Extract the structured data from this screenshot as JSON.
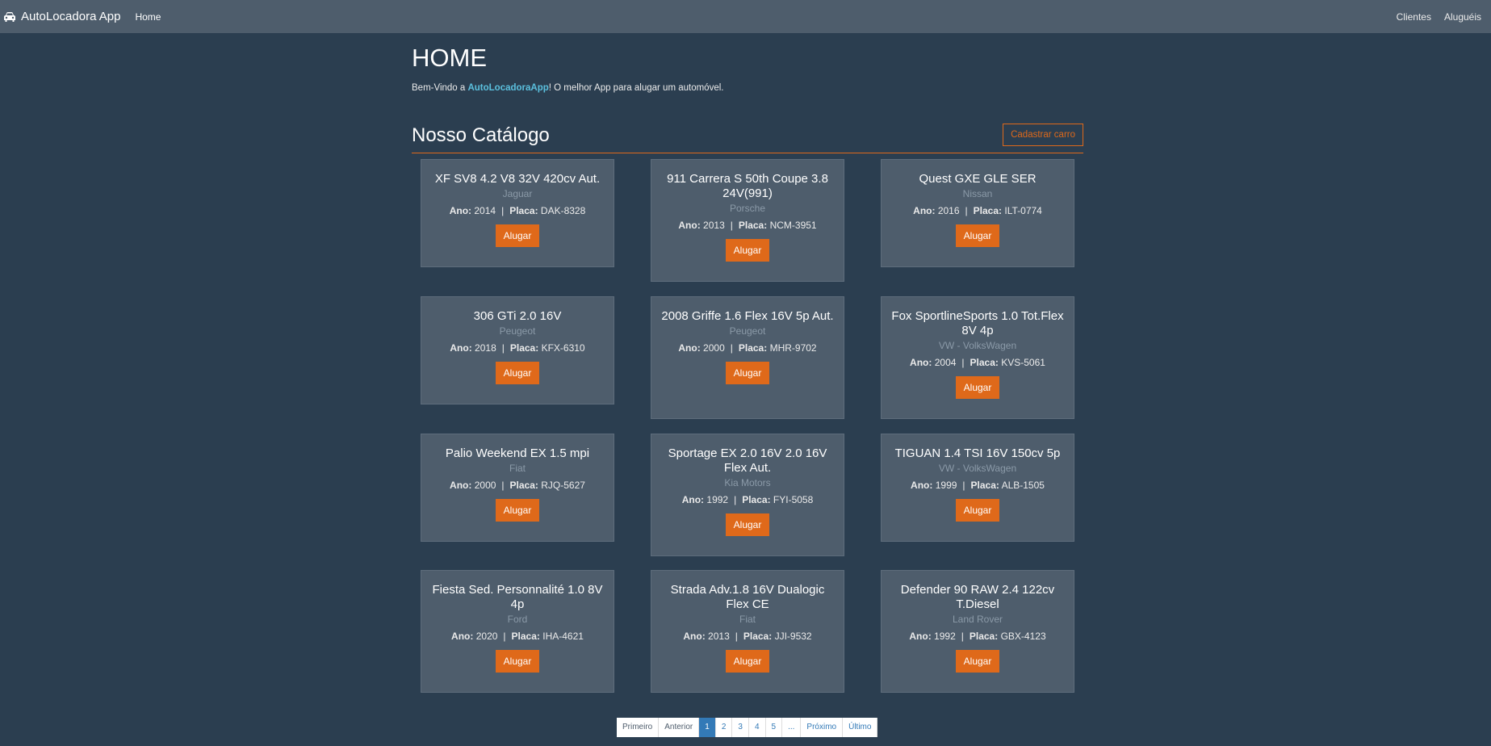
{
  "navbar": {
    "brand": "AutoLocadora App",
    "home": "Home",
    "right_links": [
      "Clientes",
      "Aluguéis"
    ]
  },
  "page": {
    "title": "HOME",
    "welcome_prefix": "Bem-Vindo a ",
    "welcome_highlight": "AutoLocadoraApp",
    "welcome_suffix": "! O melhor App para alugar um automóvel."
  },
  "catalog": {
    "title": "Nosso Catálogo",
    "add_button": "Cadastrar carro",
    "year_label": "Ano:",
    "plate_label": "Placa:",
    "rent_label": "Alugar",
    "cars": [
      {
        "model": "XF SV8 4.2 V8 32V 420cv Aut.",
        "brand": "Jaguar",
        "year": "2014",
        "plate": "DAK-8328"
      },
      {
        "model": "911 Carrera S 50th Coupe 3.8 24V(991)",
        "brand": "Porsche",
        "year": "2013",
        "plate": "NCM-3951"
      },
      {
        "model": "Quest GXE GLE SER",
        "brand": "Nissan",
        "year": "2016",
        "plate": "ILT-0774"
      },
      {
        "model": "306 GTi 2.0 16V",
        "brand": "Peugeot",
        "year": "2018",
        "plate": "KFX-6310"
      },
      {
        "model": "2008 Griffe 1.6 Flex 16V 5p Aut.",
        "brand": "Peugeot",
        "year": "2000",
        "plate": "MHR-9702"
      },
      {
        "model": "Fox SportlineSports 1.0 Tot.Flex 8V 4p",
        "brand": "VW - VolksWagen",
        "year": "2004",
        "plate": "KVS-5061"
      },
      {
        "model": "Palio Weekend EX 1.5 mpi",
        "brand": "Fiat",
        "year": "2000",
        "plate": "RJQ-5627"
      },
      {
        "model": "Sportage EX 2.0 16V 2.0 16V Flex Aut.",
        "brand": "Kia Motors",
        "year": "1992",
        "plate": "FYI-5058"
      },
      {
        "model": "TIGUAN 1.4 TSI 16V 150cv 5p",
        "brand": "VW - VolksWagen",
        "year": "1999",
        "plate": "ALB-1505"
      },
      {
        "model": "Fiesta Sed. Personnalité 1.0 8V 4p",
        "brand": "Ford",
        "year": "2020",
        "plate": "IHA-4621"
      },
      {
        "model": "Strada Adv.1.8 16V Dualogic Flex CE",
        "brand": "Fiat",
        "year": "2013",
        "plate": "JJI-9532"
      },
      {
        "model": "Defender 90 RAW 2.4 122cv T.Diesel",
        "brand": "Land Rover",
        "year": "1992",
        "plate": "GBX-4123"
      }
    ]
  },
  "pagination": {
    "items": [
      "Primeiro",
      "Anterior",
      "1",
      "2",
      "3",
      "4",
      "5",
      "...",
      "Próximo",
      "Último"
    ],
    "active": "1"
  },
  "colors": {
    "background": "#2b3e50",
    "navbar": "#4e5d6c",
    "accent": "#df691a",
    "link": "#5bc0de"
  }
}
